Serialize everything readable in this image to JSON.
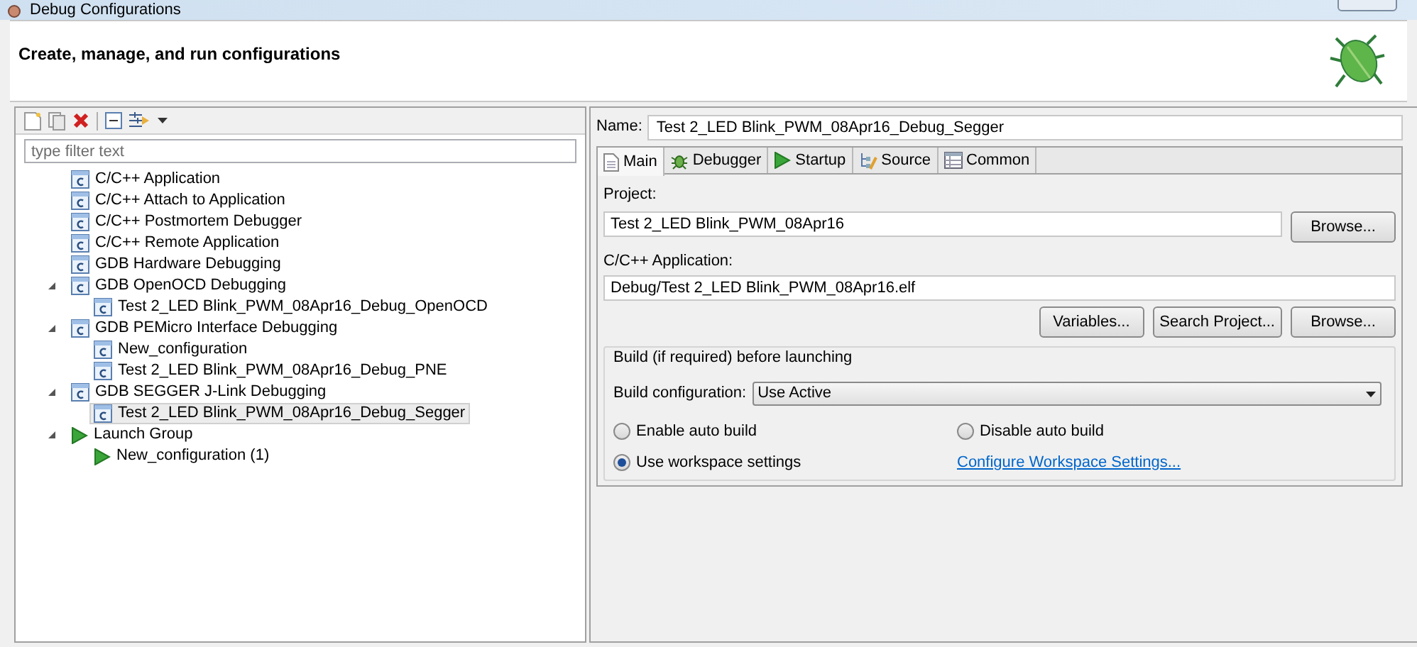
{
  "window": {
    "title": "Debug Configurations"
  },
  "header": {
    "title": "Create, manage, and run configurations"
  },
  "filter": {
    "placeholder": "type filter text"
  },
  "tree": [
    {
      "label": "C/C++ Application",
      "kind": "config",
      "selected": false
    },
    {
      "label": "C/C++ Attach to Application",
      "kind": "config",
      "selected": false
    },
    {
      "label": "C/C++ Postmortem Debugger",
      "kind": "config",
      "selected": false
    },
    {
      "label": "C/C++ Remote Application",
      "kind": "config",
      "selected": false
    },
    {
      "label": "GDB Hardware Debugging",
      "kind": "config",
      "selected": false
    },
    {
      "label": "GDB OpenOCD Debugging",
      "kind": "config",
      "selected": false,
      "expanded": true,
      "children": [
        {
          "label": "Test 2_LED Blink_PWM_08Apr16_Debug_OpenOCD",
          "kind": "config",
          "selected": false
        }
      ]
    },
    {
      "label": "GDB PEMicro Interface Debugging",
      "kind": "config",
      "selected": false,
      "expanded": true,
      "children": [
        {
          "label": "New_configuration",
          "kind": "config",
          "selected": false
        },
        {
          "label": "Test 2_LED Blink_PWM_08Apr16_Debug_PNE",
          "kind": "config",
          "selected": false
        }
      ]
    },
    {
      "label": "GDB SEGGER J-Link Debugging",
      "kind": "config",
      "selected": false,
      "expanded": true,
      "children": [
        {
          "label": "Test 2_LED Blink_PWM_08Apr16_Debug_Segger",
          "kind": "config",
          "selected": true
        }
      ]
    },
    {
      "label": "Launch Group",
      "kind": "launch",
      "selected": false,
      "expanded": true,
      "children": [
        {
          "label": "New_configuration (1)",
          "kind": "launch",
          "selected": false
        }
      ]
    }
  ],
  "name": {
    "label": "Name:",
    "value": "Test 2_LED Blink_PWM_08Apr16_Debug_Segger"
  },
  "tabs": [
    {
      "label": "Main",
      "kind": "main",
      "selected": true
    },
    {
      "label": "Debugger",
      "kind": "debugger",
      "selected": false
    },
    {
      "label": "Startup",
      "kind": "startup",
      "selected": false
    },
    {
      "label": "Source",
      "kind": "source",
      "selected": false
    },
    {
      "label": "Common",
      "kind": "common",
      "selected": false
    }
  ],
  "project": {
    "label": "Project:",
    "value": "Test 2_LED Blink_PWM_08Apr16",
    "button": "Browse..."
  },
  "application": {
    "label": "C/C++ Application:",
    "value": "Debug/Test 2_LED Blink_PWM_08Apr16.elf",
    "buttons": [
      "Variables...",
      "Search Project...",
      "Browse..."
    ]
  },
  "build": {
    "title": "Build (if required) before launching",
    "config_label": "Build configuration:",
    "config_value": "Use Active",
    "options": [
      {
        "label": "Enable auto build",
        "selected": false
      },
      {
        "label": "Disable auto build",
        "selected": false
      },
      {
        "label": "Use workspace settings",
        "selected": true
      }
    ],
    "link": "Configure Workspace Settings..."
  }
}
